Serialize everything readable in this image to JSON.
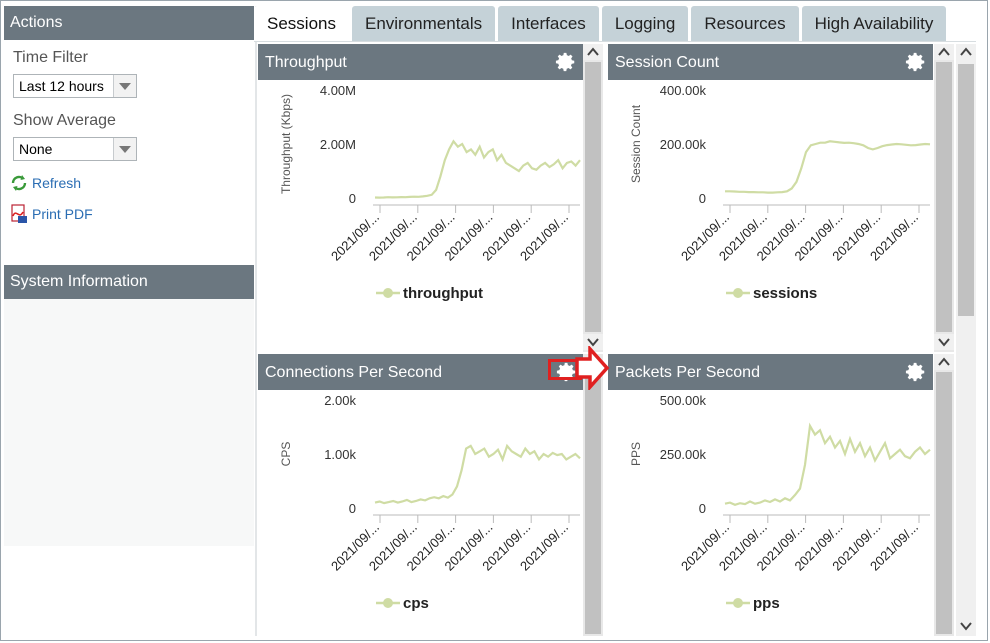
{
  "actions": {
    "header": "Actions",
    "time_filter_label": "Time Filter",
    "time_filter_value": "Last 12 hours",
    "show_average_label": "Show Average",
    "show_average_value": "None",
    "refresh": "Refresh",
    "print_pdf": "Print PDF"
  },
  "system_info": {
    "header": "System Information"
  },
  "tabs": [
    "Sessions",
    "Environmentals",
    "Interfaces",
    "Logging",
    "Resources",
    "High Availability"
  ],
  "panels": [
    {
      "title": "Throughput"
    },
    {
      "title": "Session Count"
    },
    {
      "title": "Connections Per Second"
    },
    {
      "title": "Packets Per Second"
    }
  ],
  "chart_data": [
    {
      "type": "area",
      "ylabel": "Throughput (Kbps)",
      "yticks": [
        "4.00M",
        "2.00M",
        "0"
      ],
      "ylim": [
        0,
        4000000
      ],
      "xticks": [
        "2021/09/...",
        "2021/09/...",
        "2021/09/...",
        "2021/09/...",
        "2021/09/...",
        "2021/09/..."
      ],
      "series": [
        {
          "name": "throughput",
          "values": [
            20000,
            15000,
            18000,
            30000,
            22000,
            25000,
            35000,
            28000,
            40000,
            50000,
            45000,
            60000,
            80000,
            120000,
            300000,
            800000,
            1400000,
            1800000,
            2100000,
            1900000,
            2000000,
            1700000,
            1800000,
            1600000,
            1900000,
            1500000,
            1700000,
            1800000,
            1400000,
            1600000,
            1300000,
            1200000,
            1100000,
            1000000,
            1200000,
            1300000,
            1100000,
            1050000,
            1200000,
            1300000,
            1150000,
            1250000,
            1400000,
            1100000,
            1300000,
            1350000,
            1200000,
            1400000
          ]
        }
      ]
    },
    {
      "type": "area",
      "ylabel": "Session Count",
      "yticks": [
        "400.00k",
        "200.00k",
        "0"
      ],
      "ylim": [
        0,
        400000
      ],
      "xticks": [
        "2021/09/...",
        "2021/09/...",
        "2021/09/...",
        "2021/09/...",
        "2021/09/...",
        "2021/09/..."
      ],
      "series": [
        {
          "name": "sessions",
          "values": [
            25000,
            25000,
            24000,
            23000,
            23000,
            22000,
            22000,
            21000,
            21000,
            20000,
            20000,
            21000,
            22000,
            25000,
            35000,
            60000,
            110000,
            170000,
            195000,
            200000,
            205000,
            205000,
            210000,
            208000,
            206000,
            204000,
            205000,
            203000,
            200000,
            195000,
            185000,
            180000,
            185000,
            192000,
            196000,
            198000,
            200000,
            199000,
            197000,
            195000,
            196000,
            198000,
            200000,
            199000
          ]
        }
      ]
    },
    {
      "type": "area",
      "ylabel": "CPS",
      "yticks": [
        "2.00k",
        "1.00k",
        "0"
      ],
      "ylim": [
        0,
        2000
      ],
      "xticks": [
        "2021/09/...",
        "2021/09/...",
        "2021/09/...",
        "2021/09/...",
        "2021/09/...",
        "2021/09/..."
      ],
      "series": [
        {
          "name": "cps",
          "values": [
            100,
            120,
            90,
            110,
            130,
            100,
            120,
            150,
            110,
            130,
            160,
            140,
            180,
            200,
            180,
            220,
            190,
            250,
            400,
            700,
            1100,
            1150,
            1000,
            1050,
            1100,
            950,
            1000,
            1080,
            900,
            1150,
            1050,
            1000,
            950,
            1100,
            1000,
            1050,
            900,
            1000,
            950,
            1020,
            980,
            1000,
            900,
            950,
            1000,
            920
          ]
        }
      ]
    },
    {
      "type": "area",
      "ylabel": "PPS",
      "yticks": [
        "500.00k",
        "250.00k",
        "0"
      ],
      "ylim": [
        0,
        500000
      ],
      "xticks": [
        "2021/09/...",
        "2021/09/...",
        "2021/09/...",
        "2021/09/...",
        "2021/09/...",
        "2021/09/..."
      ],
      "series": [
        {
          "name": "pps",
          "values": [
            20000,
            25000,
            15000,
            22000,
            18000,
            30000,
            20000,
            25000,
            35000,
            28000,
            40000,
            30000,
            45000,
            35000,
            60000,
            90000,
            200000,
            380000,
            340000,
            360000,
            300000,
            330000,
            280000,
            310000,
            250000,
            320000,
            260000,
            300000,
            240000,
            280000,
            220000,
            260000,
            300000,
            230000,
            250000,
            270000,
            240000,
            230000,
            260000,
            280000,
            250000,
            270000
          ]
        }
      ]
    }
  ],
  "colors": {
    "series": "#cfdca4",
    "header": "#6b7780",
    "tab": "#c5d2d8",
    "callout": "#e02020"
  }
}
